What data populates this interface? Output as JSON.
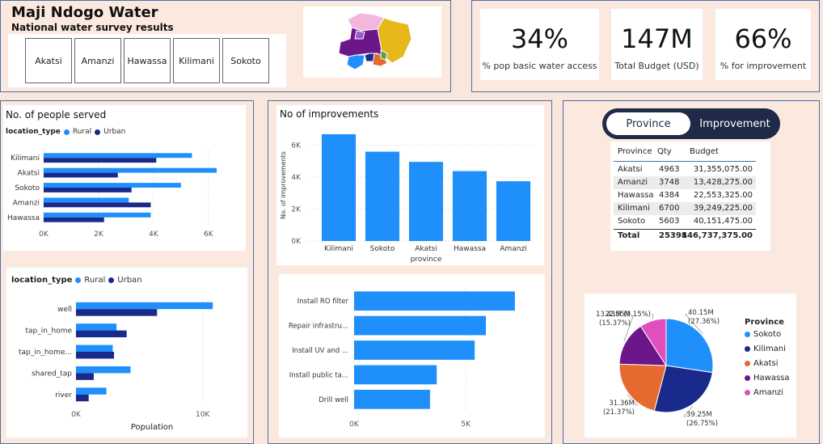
{
  "header": {
    "title": "Maji Ndogo Water",
    "subtitle": "National water survey results",
    "slicers": [
      "Akatsi",
      "Amanzi",
      "Hawassa",
      "Kilimani",
      "Sokoto"
    ]
  },
  "map": {
    "colors": {
      "pink": "#f3b6dc",
      "yellow": "#e6b81a",
      "purple": "#6d168a",
      "blue": "#1f8ffc",
      "orange": "#e46a2f",
      "navy": "#1a2d8f"
    }
  },
  "kpis": [
    {
      "value": "34%",
      "label": "% pop basic water access"
    },
    {
      "value": "147M",
      "label": "Total Budget (USD)"
    },
    {
      "value": "66%",
      "label": "% for improvement"
    }
  ],
  "colors": {
    "rural": "#1f8ffc",
    "urban": "#1a2a8c",
    "panel_border": "#4a6fa5"
  },
  "people_served": {
    "title": "No. of people served",
    "legend_title": "location_type",
    "legend": [
      "Rural",
      "Urban"
    ],
    "chart_data": {
      "type": "bar",
      "orientation": "horizontal",
      "categories": [
        "Kilimani",
        "Akatsi",
        "Sokoto",
        "Amanzi",
        "Hawassa"
      ],
      "series": [
        {
          "name": "Rural",
          "values": [
            5400,
            6300,
            5000,
            3100,
            3900
          ]
        },
        {
          "name": "Urban",
          "values": [
            4100,
            2700,
            3200,
            3900,
            2200
          ]
        }
      ],
      "xlim": [
        0,
        6800
      ],
      "xticks": [
        "0K",
        "2K",
        "4K",
        "6K"
      ]
    }
  },
  "population_by_source": {
    "legend_title": "location_type",
    "legend": [
      "Rural",
      "Urban"
    ],
    "xlabel": "Population",
    "chart_data": {
      "type": "bar",
      "orientation": "horizontal",
      "categories": [
        "well",
        "tap_in_home",
        "tap_in_home...",
        "shared_tap",
        "river"
      ],
      "series": [
        {
          "name": "Rural",
          "values": [
            10800,
            3200,
            2900,
            4300,
            2400
          ]
        },
        {
          "name": "Urban",
          "values": [
            6400,
            4000,
            3000,
            1400,
            1000
          ]
        }
      ],
      "xlim": [
        0,
        12000
      ],
      "xticks": [
        "0K",
        "10K"
      ]
    }
  },
  "improvements": {
    "title": "No of improvements",
    "ylabel": "No. of improvements",
    "xlabel": "province",
    "chart_data": {
      "type": "bar",
      "categories": [
        "Kilimani",
        "Sokoto",
        "Akatsi",
        "Hawassa",
        "Amanzi"
      ],
      "values": [
        6700,
        5603,
        4963,
        4384,
        3748
      ],
      "ylim": [
        0,
        7000
      ],
      "yticks": [
        "0K",
        "2K",
        "4K",
        "6K"
      ]
    }
  },
  "improvement_types": {
    "chart_data": {
      "type": "bar",
      "orientation": "horizontal",
      "categories": [
        "Install RO filter",
        "Repair infrastru...",
        "Install UV and ...",
        "Install public ta...",
        "Drill well"
      ],
      "values": [
        7200,
        5900,
        5400,
        3700,
        3400
      ],
      "xlim": [
        0,
        8000
      ],
      "xticks": [
        "0K",
        "5K"
      ]
    }
  },
  "toggle": {
    "options": [
      "Province",
      "Improvement"
    ],
    "selected": "Province"
  },
  "budget_table": {
    "columns": [
      "Province",
      "Qty",
      "Budget"
    ],
    "rows": [
      [
        "Akatsi",
        "4963",
        "31,355,075.00"
      ],
      [
        "Amanzi",
        "3748",
        "13,428,275.00"
      ],
      [
        "Hawassa",
        "4384",
        "22,553,325.00"
      ],
      [
        "Kilimani",
        "6700",
        "39,249,225.00"
      ],
      [
        "Sokoto",
        "5603",
        "40,151,475.00"
      ]
    ],
    "total": [
      "Total",
      "25398",
      "146,737,375.00"
    ]
  },
  "budget_pie": {
    "legend_title": "Province",
    "chart_data": {
      "type": "pie",
      "slices": [
        {
          "name": "Sokoto",
          "value": 40.15,
          "label": "40.15M",
          "pct": "(27.36%)",
          "color": "#1f8ffc"
        },
        {
          "name": "Kilimani",
          "value": 39.25,
          "label": "39.25M",
          "pct": "(26.75%)",
          "color": "#1a2a8c"
        },
        {
          "name": "Akatsi",
          "value": 31.36,
          "label": "31.36M",
          "pct": "(21.37%)",
          "color": "#e46a2f"
        },
        {
          "name": "Hawassa",
          "value": 22.55,
          "label": "22.55M",
          "pct": "(15.37%)",
          "color": "#6d168a"
        },
        {
          "name": "Amanzi",
          "value": 13.43,
          "label": "13.43M",
          "pct": "(9.15%)",
          "color": "#e04fbd"
        }
      ]
    }
  }
}
